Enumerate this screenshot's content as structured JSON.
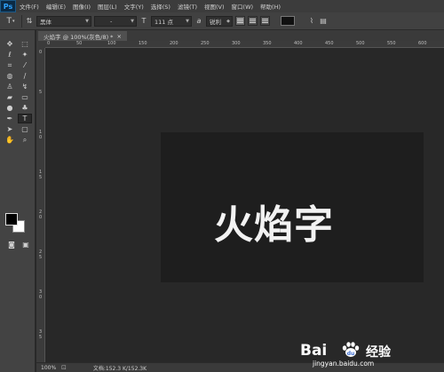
{
  "app": {
    "logo": "Ps"
  },
  "menu": [
    "文件(F)",
    "编辑(E)",
    "图像(I)",
    "图层(L)",
    "文字(Y)",
    "选择(S)",
    "滤镜(T)",
    "视图(V)",
    "窗口(W)",
    "帮助(H)"
  ],
  "options": {
    "tool_icon": "type-tool-icon",
    "font_family": "黑体",
    "font_style": "-",
    "size_icon": "T",
    "font_size": "111 点",
    "aa_icon": "a",
    "anti_alias": "锐利",
    "text_color": "#111111"
  },
  "document": {
    "tab_title": "火焰字 @ 100%(灰色/8) *",
    "close": "×",
    "text": "火焰字",
    "ruler_top": [
      "0",
      "50",
      "100",
      "150",
      "200",
      "250",
      "300",
      "350",
      "400",
      "450",
      "500",
      "550",
      "600"
    ],
    "ruler_left": [
      "0",
      "5",
      "1 0",
      "1 5",
      "2 0",
      "2 5",
      "3 0",
      "3 5"
    ]
  },
  "status": {
    "zoom": "100%",
    "doc": "文档:152.3 K/152.3K"
  },
  "watermark": {
    "brand": "Bai",
    "brand2": "经验",
    "url": "jingyan.baidu.com"
  }
}
